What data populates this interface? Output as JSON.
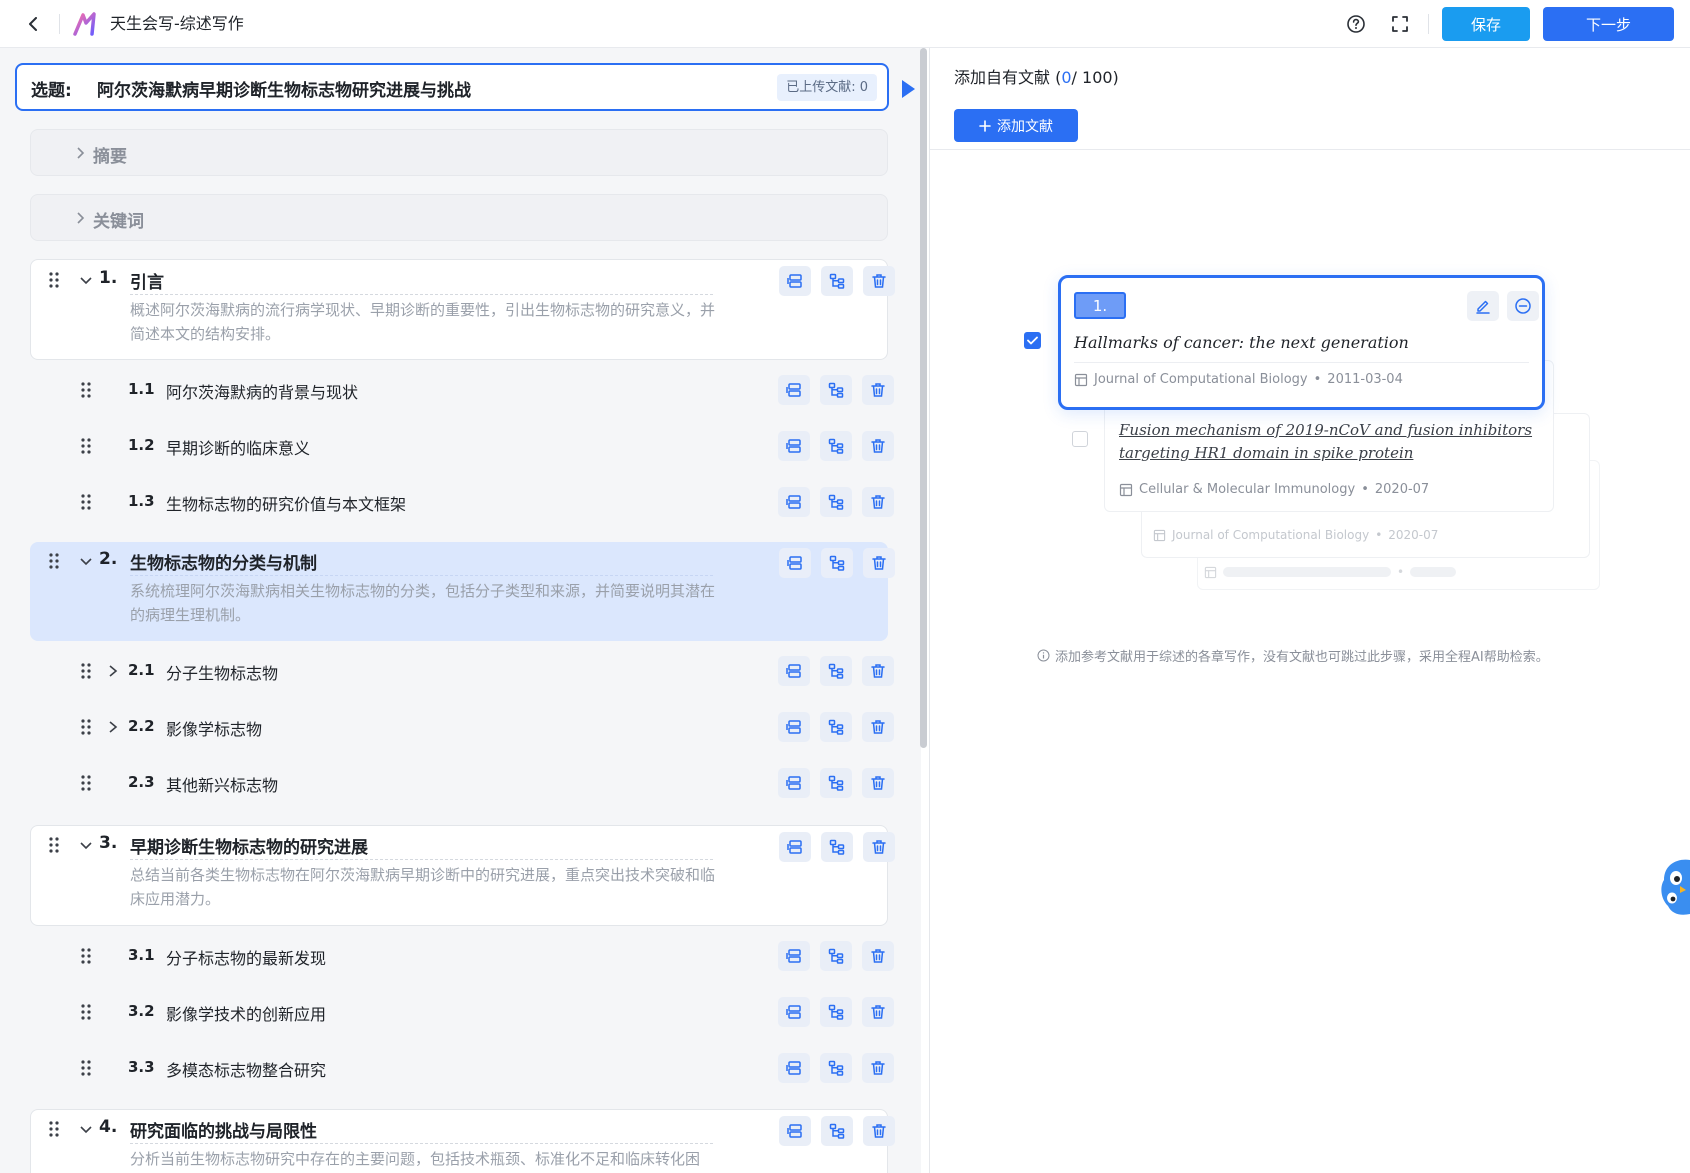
{
  "header": {
    "app_title": "天生会写-综述写作",
    "save_label": "保存",
    "next_label": "下一步"
  },
  "outline": {
    "topic_label": "选题:",
    "topic_value": "阿尔茨海默病早期诊断生物标志物研究进展与挑战",
    "uploaded_badge": "已上传文献: 0",
    "abstract_label": "摘要",
    "keywords_label": "关键词",
    "chapters": [
      {
        "num": "1.",
        "title": "引言",
        "desc": "概述阿尔茨海默病的流行病学现状、早期诊断的重要性，引出生物标志物的研究意义，并简述本文的结构安排。",
        "subs": [
          {
            "num": "1.1",
            "title": "阿尔茨海默病的背景与现状"
          },
          {
            "num": "1.2",
            "title": "早期诊断的临床意义"
          },
          {
            "num": "1.3",
            "title": "生物标志物的研究价值与本文框架"
          }
        ]
      },
      {
        "num": "2.",
        "title": "生物标志物的分类与机制",
        "desc": "系统梳理阿尔茨海默病相关生物标志物的分类，包括分子类型和来源，并简要说明其潜在的病理生理机制。",
        "subs": [
          {
            "num": "2.1",
            "title": "分子生物标志物"
          },
          {
            "num": "2.2",
            "title": "影像学标志物"
          },
          {
            "num": "2.3",
            "title": "其他新兴标志物"
          }
        ]
      },
      {
        "num": "3.",
        "title": "早期诊断生物标志物的研究进展",
        "desc": "总结当前各类生物标志物在阿尔茨海默病早期诊断中的研究进展，重点突出技术突破和临床应用潜力。",
        "subs": [
          {
            "num": "3.1",
            "title": "分子标志物的最新发现"
          },
          {
            "num": "3.2",
            "title": "影像学技术的创新应用"
          },
          {
            "num": "3.3",
            "title": "多模态标志物整合研究"
          }
        ]
      },
      {
        "num": "4.",
        "title": "研究面临的挑战与局限性",
        "desc": "分析当前生物标志物研究中存在的主要问题，包括技术瓶颈、标准化不足和临床转化困"
      }
    ]
  },
  "references": {
    "title_prefix": "添加自有文献 (",
    "count_current": "0",
    "count_total": "/ 100)",
    "add_label": "添加文献",
    "card1": {
      "index": "1.",
      "title": "Hallmarks of cancer: the next generation",
      "journal": "Journal of Computational Biology",
      "sep": "•",
      "date": "2011-03-04"
    },
    "card2": {
      "title": "Fusion mechanism of 2019-nCoV and fusion inhibitors targeting HR1 domain in spike protein",
      "journal": "Cellular & Molecular Immunology",
      "sep": "•",
      "date": "2020-07"
    },
    "card3": {
      "journal": "Journal of Computational Biology",
      "sep": "•",
      "date": "2020-07"
    },
    "card4": {
      "sep": "•"
    },
    "hint": "添加参考文献用于综述的各章写作，没有文献也可跳过此步骤，采用全程AI帮助检索。"
  },
  "colors": {
    "primary": "#2b6ff3",
    "save": "#1a9cf0",
    "active_chapter_bg": "#dbe7fd"
  }
}
